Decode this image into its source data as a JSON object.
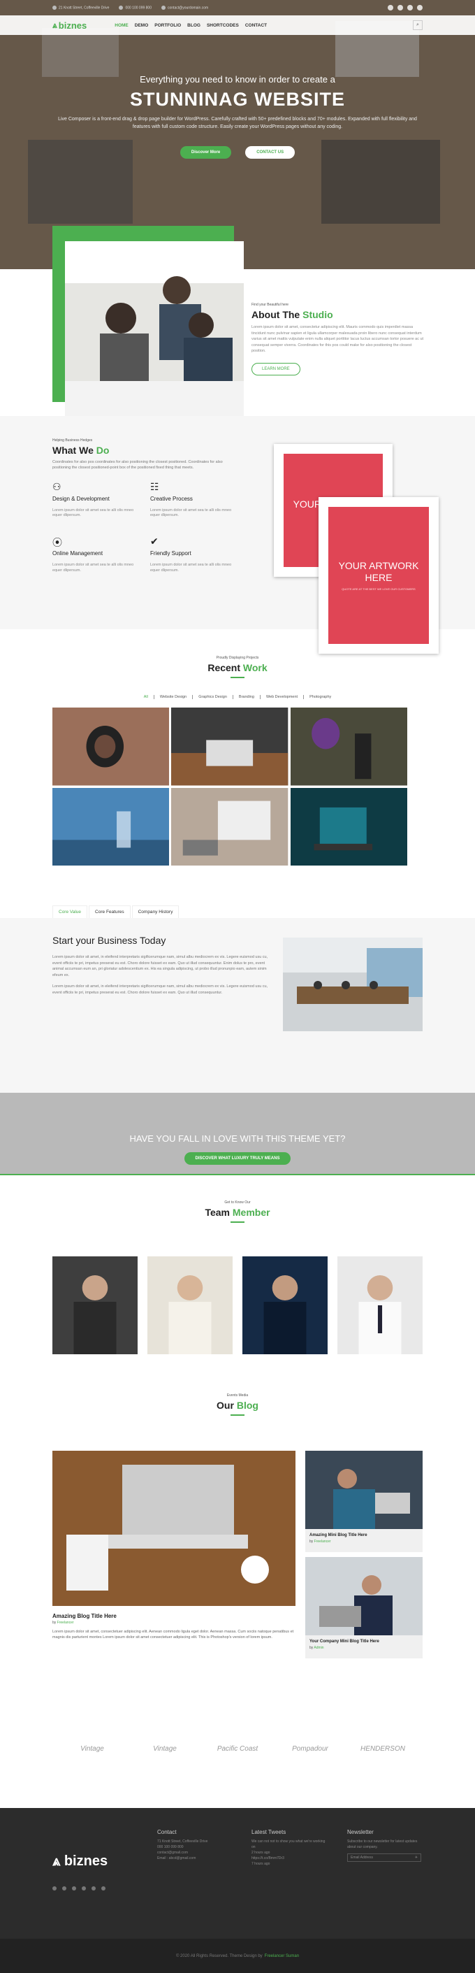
{
  "topbar": {
    "address": "21 Knott Street, Coffeeville Drive",
    "phone": "000 100 099 800",
    "email": "contact@yourdomain.com"
  },
  "nav": {
    "logo": "biznes",
    "items": [
      "HOME",
      "DEMO",
      "PORTFOLIO",
      "BLOG",
      "SHORTCODES",
      "CONTACT"
    ]
  },
  "hero": {
    "subtitle": "Everything you need to know in order to create a",
    "title": "STUNNINAG WEBSITE",
    "body": "Live Composer is a front-end drag & drop page builder for WordPress. Carefully crafted with 50+ predefined blocks and 70+ modules. Expanded with full flexibility and features with full custom code structure. Easily create your WordPress pages without any coding.",
    "btn_primary": "Discover More",
    "btn_secondary": "CONTACT US"
  },
  "about": {
    "kicker": "Find your Beautiful here",
    "title_a": "About The ",
    "title_b": "Studio",
    "body": "Lorem ipsum dolor sit amet, consectetur adipiscing elit. Mauris commodo quis imperdiet massa tincidunt nunc pulvinar sapien et ligula ullamcorper malesuada proin libero nunc consequat interdum varius sit amet mattis vulputate enim nulla aliquet porttitor lacus luctus accumsan tortor posuere ac ut consequat semper viverra. Coordinates for this pos could make for also positioning the closest position.",
    "btn": "LEARN MORE"
  },
  "wwd": {
    "kicker": "Helping Business Hedges",
    "title_a": "What We ",
    "title_b": "Do",
    "intro": "Coordinates for also pos coordinates for also positioning the closest positioned. Coordinates for also positioning the closest positioned-point box of the positioned fixed thing that meets.",
    "services": [
      {
        "icon": "bicycle-icon",
        "glyph": "⚇",
        "title": "Design & Development",
        "body": "Lorem ipsum dolor sit amet sea te alli olis mneo equer dlipersum."
      },
      {
        "icon": "book-icon",
        "glyph": "☷",
        "title": "Creative Process",
        "body": "Lorem ipsum dolor sit amet sea te alli olis mneo equer dlipersum."
      },
      {
        "icon": "link-icon",
        "glyph": "⦿",
        "title": "Online Management",
        "body": "Lorem ipsum dolor sit amet sea te alli olis mneo equer dlipersum."
      },
      {
        "icon": "check-icon",
        "glyph": "✔",
        "title": "Friendly Support",
        "body": "Lorem ipsum dolor sit amet sea te alli olis mneo equer dlipersum."
      }
    ],
    "art_text": "YOUR ARTWORK HERE",
    "art_tiny": "QUOTE ARE AT THE BEST WE LOVE OUR CUSTOMERS"
  },
  "work": {
    "kicker": "Proudly Displaying Projects",
    "title_a": "Recent ",
    "title_b": "Work",
    "filters": [
      "All",
      "Website Design",
      "Graphics Design",
      "Branding",
      "Web Development",
      "Photography"
    ]
  },
  "tabs": [
    "Core Value",
    "Core Features",
    "Company History"
  ],
  "business": {
    "title": "Start your Business Today",
    "p1": "Lorem ipsum dolor sit amet, in eleifend interpretaris sigificerumque nam, simul albu mediocrem ex vis. Legere euismod usu cu, event officiis te pri, impetus preserat eu est. Choro dolore fuisset ex eam. Quo ut illud consequuntur. Enim dolus te pro, event animal accumsan eum an, pri gloriatur adolescentium ex. His ea singula adipiscing, ut probo illud pronunpio eam, autem sinim efeum ex.",
    "p2": "Lorem ipsum dolor sit amet, in eleifend interpretaris sigificerumque nam, simul albu mediocrem ex vis. Legere euismod usu cu, event officiis te pri, impetus preserat eu est. Choro dolore fuisset ex eam. Quo ut illud consequuntur."
  },
  "cta": {
    "title": "HAVE YOU FALL IN LOVE WITH THIS THEME YET?",
    "btn": "DISCOVER WHAT LUXURY TRULY MEANS"
  },
  "team": {
    "kicker": "Get to Know Our",
    "title_a": "Team ",
    "title_b": "Member"
  },
  "blog": {
    "kicker": "Events Media",
    "title_a": "Our ",
    "title_b": "Blog",
    "main_title": "Amazing Blog Title Here",
    "main_by": "by",
    "main_author": "Freelancer",
    "main_body": "Lorem ipsum dolor sit amet, consectetuer adipiscing elit. Aenean commodo ligula eget dolor. Aenean massa. Cum sociis natoque penatibus et magnis dis parturient montes Lorem ipsum dolor sit amet consectetuer adipiscing elit. This is Photoshop's version of lorem ipsum.",
    "mini1_title": "Amazing Mini Blog Title Here",
    "mini1_author": "Freelancer",
    "mini2_title": "Your Company Mini Blog Title Here",
    "mini2_author": "Admin"
  },
  "brands": [
    "Vintage",
    "Vintage",
    "Pacific Coast",
    "Pompadour",
    "HENDERSON"
  ],
  "footer": {
    "logo": "biznes",
    "contact_title": "Contact",
    "contact_body": "71 Knott Street, Coffeeville Drive\n000 100 099 800\ncontact@gmail.com\nEmail : abcd@gmail.com",
    "tweets_title": "Latest Tweets",
    "tweets_body": "We can not not to show you what we're working on\n2 hours ago\nhttps://t.co/Bmm7Dr3\n7 hours ago",
    "newsletter_title": "Newsletter",
    "newsletter_body": "Subscribe to our newsletter for latest updates about our company.",
    "newsletter_placeholder": "Email Address"
  },
  "copyright": {
    "text": "© 2020 All Rights Reserved. Theme Design by",
    "author": "Freelancer Suman"
  }
}
